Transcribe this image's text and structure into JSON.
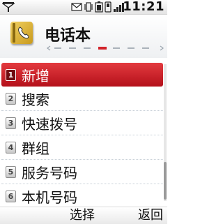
{
  "status_bar": {
    "time": "11:21",
    "icons": [
      "signal-bars-icon",
      "message-envelope-icon",
      "vibrate-icon",
      "battery-icon",
      "phone-icon",
      "signal-bars-2-icon"
    ]
  },
  "header": {
    "title": "电话本",
    "icon": "phonebook-icon",
    "page_indicator": {
      "count": 7,
      "active": 4
    }
  },
  "menu": {
    "items": [
      {
        "num": "1",
        "label": "新增",
        "selected": true
      },
      {
        "num": "2",
        "label": "搜索",
        "selected": false
      },
      {
        "num": "3",
        "label": "快速拨号",
        "selected": false
      },
      {
        "num": "4",
        "label": "群组",
        "selected": false
      },
      {
        "num": "5",
        "label": "服务号码",
        "selected": false
      },
      {
        "num": "6",
        "label": "本机号码",
        "selected": false
      }
    ]
  },
  "softkeys": {
    "left": "选择",
    "right": "返回"
  },
  "colors": {
    "accent": "#d2232a",
    "header_bg": "#eef0f2"
  }
}
